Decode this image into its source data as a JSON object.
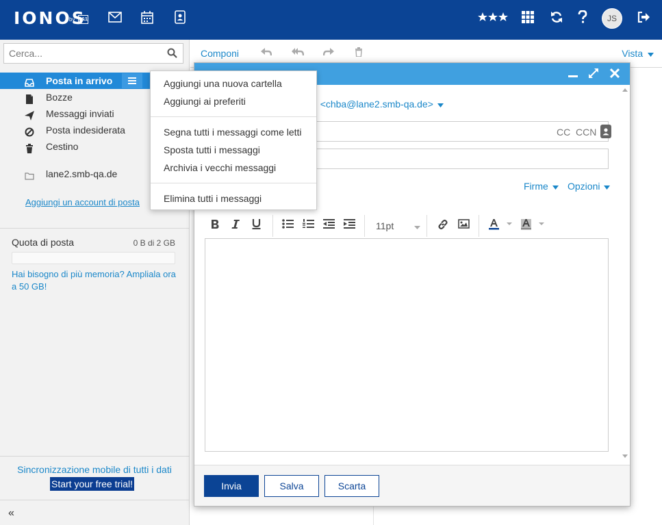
{
  "header": {
    "logo": "IONOS",
    "logo_by": "by",
    "logo_brand": "1&1",
    "avatar_initials": "JS",
    "icons": [
      "mail-icon",
      "calendar-icon",
      "contacts-icon",
      "stars-icon",
      "apps-grid-icon",
      "refresh-icon",
      "help-icon",
      "logout-icon"
    ]
  },
  "sidebar": {
    "search_placeholder": "Cerca...",
    "folders": [
      {
        "label": "Posta in arrivo",
        "icon": "inbox-icon"
      },
      {
        "label": "Bozze",
        "icon": "draft-icon"
      },
      {
        "label": "Messaggi inviati",
        "icon": "send-icon"
      },
      {
        "label": "Posta indesiderata",
        "icon": "spam-icon"
      },
      {
        "label": "Cestino",
        "icon": "trash-icon"
      },
      {
        "label": "lane2.smb-qa.de",
        "icon": "folder-icon"
      }
    ],
    "add_account": "Aggiungi un account di posta",
    "quota_label": "Quota di posta",
    "quota_value": "0 B di 2 GB",
    "quota_used_fraction": 0,
    "quota_more": "Hai bisogno di più memoria? Ampliala ora a 50 GB!",
    "sync_text": "Sincronizzazione mobile di tutti i dati",
    "trial_label": "Start your free trial!",
    "collapse_label": "«"
  },
  "toolbar": {
    "compose": "Componi",
    "view": "Vista"
  },
  "compose": {
    "from_prefix": "h",
    "from_address": "<chba@lane2.smb-qa.de>",
    "cc": "CC",
    "ccn": "CCN",
    "signatures": "Firme",
    "options": "Opzioni",
    "font_size": "11pt",
    "send": "Invia",
    "save": "Salva",
    "discard": "Scarta"
  },
  "context_menu": {
    "items": [
      "Aggiungi una nuova cartella",
      "Aggiungi ai preferiti",
      "Segna tutti i messaggi come letti",
      "Sposta tutti i messaggi",
      "Archivia i vecchi messaggi",
      "Elimina tutti i messaggi"
    ]
  },
  "colors": {
    "header_bg": "#0b4495",
    "accent": "#1a87c9",
    "active_folder": "#2189d8",
    "compose_header": "#40a0e0"
  }
}
